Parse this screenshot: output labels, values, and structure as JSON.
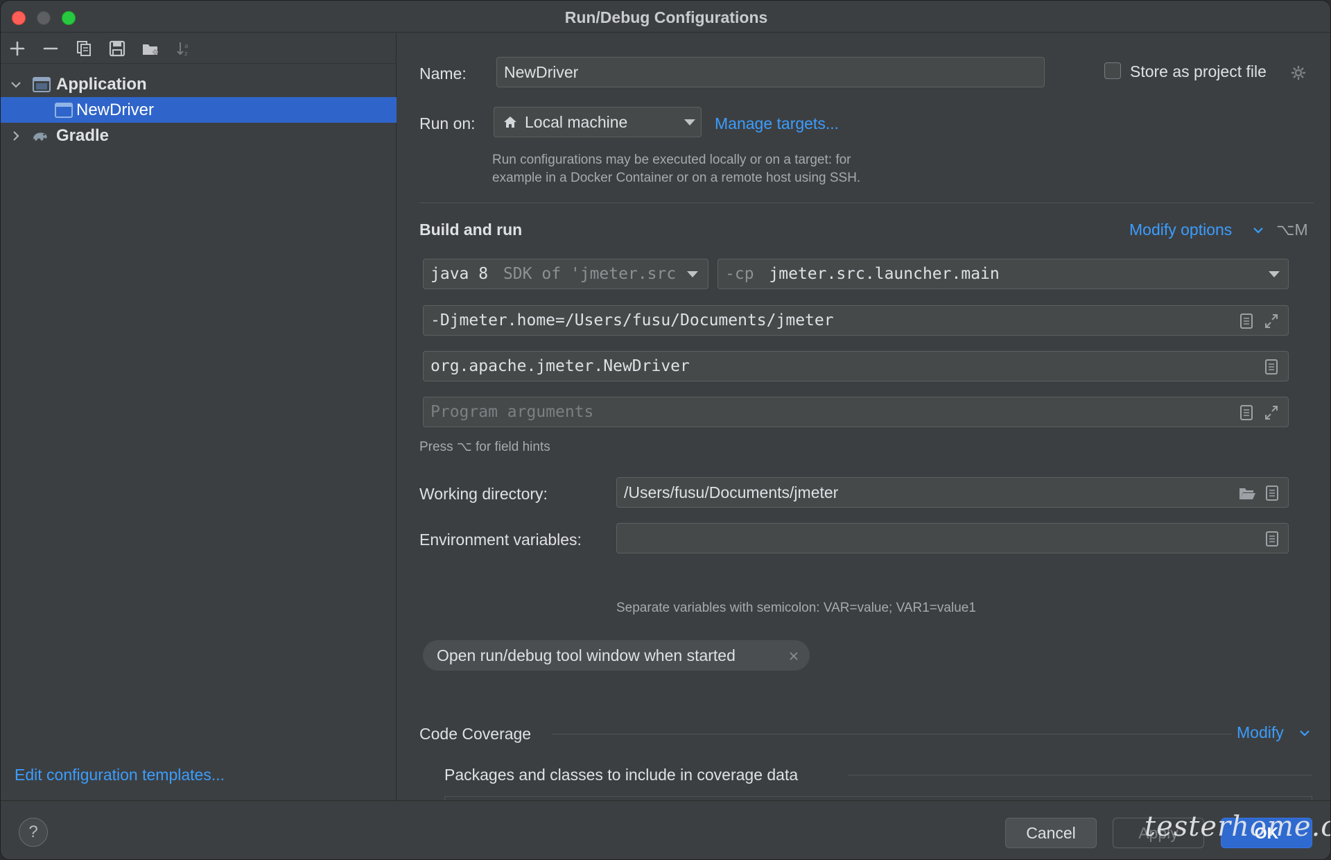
{
  "window": {
    "title": "Run/Debug Configurations"
  },
  "sidebar": {
    "toolbar_icons": [
      "plus-icon",
      "minus-icon",
      "copy-icon",
      "save-icon",
      "folder-add-icon",
      "sort-icon"
    ],
    "tree": [
      {
        "label": "Application",
        "expanded": true,
        "icon": "application-icon"
      },
      {
        "label": "NewDriver",
        "selected": true,
        "icon": "config-icon"
      },
      {
        "label": "Gradle",
        "expanded": false,
        "icon": "gradle-elephant-icon"
      }
    ],
    "edit_templates_link": "Edit configuration templates..."
  },
  "form": {
    "name_label": "Name:",
    "name_value": "NewDriver",
    "store_label": "Store as project file",
    "store_checked": false,
    "run_on_label": "Run on:",
    "run_on_value": "Local machine",
    "manage_targets": "Manage targets...",
    "run_hint_line1": "Run configurations may be executed locally or on a target: for",
    "run_hint_line2": "example in a Docker Container or on a remote host using SSH.",
    "build_run_title": "Build and run",
    "modify_options": "Modify options",
    "modify_shortcut": "⌥M",
    "sdk_main": "java 8",
    "sdk_suffix": "SDK of 'jmeter.src",
    "cp_prefix": "-cp",
    "cp_value": "jmeter.src.launcher.main",
    "vm_options": "-Djmeter.home=/Users/fusu/Documents/jmeter",
    "main_class": "org.apache.jmeter.NewDriver",
    "program_args_placeholder": "Program arguments",
    "field_hint": "Press ⌥ for field hints",
    "working_dir_label": "Working directory:",
    "working_dir_value": "/Users/fusu/Documents/jmeter",
    "env_label": "Environment variables:",
    "env_value": "",
    "env_hint": "Separate variables with semicolon: VAR=value; VAR1=value1",
    "chip_label": "Open run/debug tool window when started",
    "coverage_title": "Code Coverage",
    "coverage_modify": "Modify",
    "packages_label": "Packages and classes to include in coverage data"
  },
  "footer": {
    "help": "?",
    "cancel": "Cancel",
    "apply": "Apply",
    "ok": "OK",
    "watermark": "testerhome.com"
  },
  "colors": {
    "accent_link": "#3b9dff",
    "selection": "#2f65ca",
    "background": "#3c3f41",
    "field_bg": "#45494a"
  }
}
